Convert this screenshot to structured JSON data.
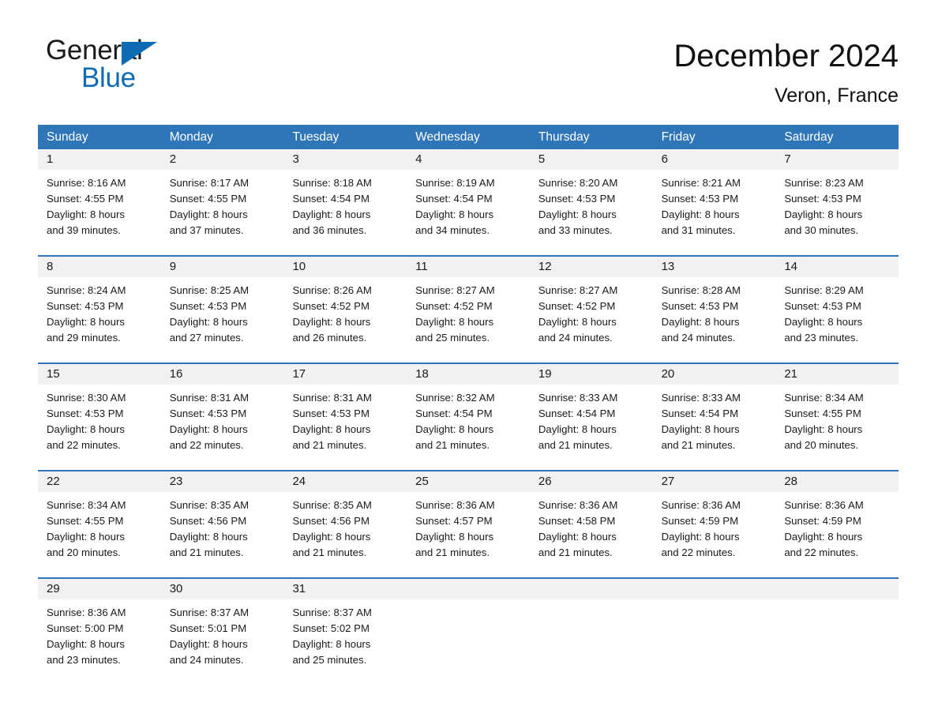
{
  "brand": {
    "name_part1": "General",
    "name_part2": "Blue",
    "triangle_color": "#0d6cb4"
  },
  "header": {
    "title": "December 2024",
    "subtitle": "Veron, France"
  },
  "theme": {
    "header_blue": "#2f76b8",
    "date_band_gray": "#f1f1f1",
    "text_color": "#1a1a1a"
  },
  "weekdays": [
    "Sunday",
    "Monday",
    "Tuesday",
    "Wednesday",
    "Thursday",
    "Friday",
    "Saturday"
  ],
  "weeks": [
    {
      "days": [
        {
          "num": "1",
          "lines": [
            "Sunrise: 8:16 AM",
            "Sunset: 4:55 PM",
            "Daylight: 8 hours",
            "and 39 minutes."
          ]
        },
        {
          "num": "2",
          "lines": [
            "Sunrise: 8:17 AM",
            "Sunset: 4:55 PM",
            "Daylight: 8 hours",
            "and 37 minutes."
          ]
        },
        {
          "num": "3",
          "lines": [
            "Sunrise: 8:18 AM",
            "Sunset: 4:54 PM",
            "Daylight: 8 hours",
            "and 36 minutes."
          ]
        },
        {
          "num": "4",
          "lines": [
            "Sunrise: 8:19 AM",
            "Sunset: 4:54 PM",
            "Daylight: 8 hours",
            "and 34 minutes."
          ]
        },
        {
          "num": "5",
          "lines": [
            "Sunrise: 8:20 AM",
            "Sunset: 4:53 PM",
            "Daylight: 8 hours",
            "and 33 minutes."
          ]
        },
        {
          "num": "6",
          "lines": [
            "Sunrise: 8:21 AM",
            "Sunset: 4:53 PM",
            "Daylight: 8 hours",
            "and 31 minutes."
          ]
        },
        {
          "num": "7",
          "lines": [
            "Sunrise: 8:23 AM",
            "Sunset: 4:53 PM",
            "Daylight: 8 hours",
            "and 30 minutes."
          ]
        }
      ]
    },
    {
      "days": [
        {
          "num": "8",
          "lines": [
            "Sunrise: 8:24 AM",
            "Sunset: 4:53 PM",
            "Daylight: 8 hours",
            "and 29 minutes."
          ]
        },
        {
          "num": "9",
          "lines": [
            "Sunrise: 8:25 AM",
            "Sunset: 4:53 PM",
            "Daylight: 8 hours",
            "and 27 minutes."
          ]
        },
        {
          "num": "10",
          "lines": [
            "Sunrise: 8:26 AM",
            "Sunset: 4:52 PM",
            "Daylight: 8 hours",
            "and 26 minutes."
          ]
        },
        {
          "num": "11",
          "lines": [
            "Sunrise: 8:27 AM",
            "Sunset: 4:52 PM",
            "Daylight: 8 hours",
            "and 25 minutes."
          ]
        },
        {
          "num": "12",
          "lines": [
            "Sunrise: 8:27 AM",
            "Sunset: 4:52 PM",
            "Daylight: 8 hours",
            "and 24 minutes."
          ]
        },
        {
          "num": "13",
          "lines": [
            "Sunrise: 8:28 AM",
            "Sunset: 4:53 PM",
            "Daylight: 8 hours",
            "and 24 minutes."
          ]
        },
        {
          "num": "14",
          "lines": [
            "Sunrise: 8:29 AM",
            "Sunset: 4:53 PM",
            "Daylight: 8 hours",
            "and 23 minutes."
          ]
        }
      ]
    },
    {
      "days": [
        {
          "num": "15",
          "lines": [
            "Sunrise: 8:30 AM",
            "Sunset: 4:53 PM",
            "Daylight: 8 hours",
            "and 22 minutes."
          ]
        },
        {
          "num": "16",
          "lines": [
            "Sunrise: 8:31 AM",
            "Sunset: 4:53 PM",
            "Daylight: 8 hours",
            "and 22 minutes."
          ]
        },
        {
          "num": "17",
          "lines": [
            "Sunrise: 8:31 AM",
            "Sunset: 4:53 PM",
            "Daylight: 8 hours",
            "and 21 minutes."
          ]
        },
        {
          "num": "18",
          "lines": [
            "Sunrise: 8:32 AM",
            "Sunset: 4:54 PM",
            "Daylight: 8 hours",
            "and 21 minutes."
          ]
        },
        {
          "num": "19",
          "lines": [
            "Sunrise: 8:33 AM",
            "Sunset: 4:54 PM",
            "Daylight: 8 hours",
            "and 21 minutes."
          ]
        },
        {
          "num": "20",
          "lines": [
            "Sunrise: 8:33 AM",
            "Sunset: 4:54 PM",
            "Daylight: 8 hours",
            "and 21 minutes."
          ]
        },
        {
          "num": "21",
          "lines": [
            "Sunrise: 8:34 AM",
            "Sunset: 4:55 PM",
            "Daylight: 8 hours",
            "and 20 minutes."
          ]
        }
      ]
    },
    {
      "days": [
        {
          "num": "22",
          "lines": [
            "Sunrise: 8:34 AM",
            "Sunset: 4:55 PM",
            "Daylight: 8 hours",
            "and 20 minutes."
          ]
        },
        {
          "num": "23",
          "lines": [
            "Sunrise: 8:35 AM",
            "Sunset: 4:56 PM",
            "Daylight: 8 hours",
            "and 21 minutes."
          ]
        },
        {
          "num": "24",
          "lines": [
            "Sunrise: 8:35 AM",
            "Sunset: 4:56 PM",
            "Daylight: 8 hours",
            "and 21 minutes."
          ]
        },
        {
          "num": "25",
          "lines": [
            "Sunrise: 8:36 AM",
            "Sunset: 4:57 PM",
            "Daylight: 8 hours",
            "and 21 minutes."
          ]
        },
        {
          "num": "26",
          "lines": [
            "Sunrise: 8:36 AM",
            "Sunset: 4:58 PM",
            "Daylight: 8 hours",
            "and 21 minutes."
          ]
        },
        {
          "num": "27",
          "lines": [
            "Sunrise: 8:36 AM",
            "Sunset: 4:59 PM",
            "Daylight: 8 hours",
            "and 22 minutes."
          ]
        },
        {
          "num": "28",
          "lines": [
            "Sunrise: 8:36 AM",
            "Sunset: 4:59 PM",
            "Daylight: 8 hours",
            "and 22 minutes."
          ]
        }
      ]
    },
    {
      "days": [
        {
          "num": "29",
          "lines": [
            "Sunrise: 8:36 AM",
            "Sunset: 5:00 PM",
            "Daylight: 8 hours",
            "and 23 minutes."
          ]
        },
        {
          "num": "30",
          "lines": [
            "Sunrise: 8:37 AM",
            "Sunset: 5:01 PM",
            "Daylight: 8 hours",
            "and 24 minutes."
          ]
        },
        {
          "num": "31",
          "lines": [
            "Sunrise: 8:37 AM",
            "Sunset: 5:02 PM",
            "Daylight: 8 hours",
            "and 25 minutes."
          ]
        },
        {
          "num": "",
          "lines": []
        },
        {
          "num": "",
          "lines": []
        },
        {
          "num": "",
          "lines": []
        },
        {
          "num": "",
          "lines": []
        }
      ]
    }
  ]
}
